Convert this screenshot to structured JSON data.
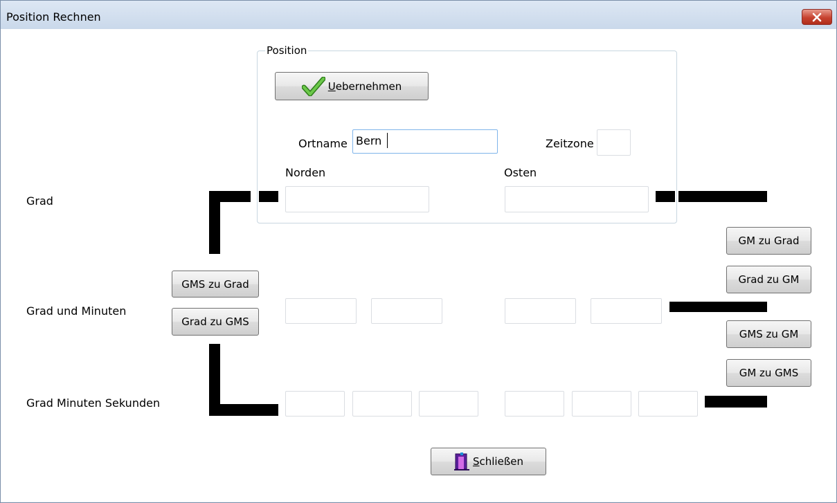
{
  "window": {
    "title": "Position Rechnen"
  },
  "group": {
    "legend": "Position"
  },
  "buttons": {
    "uebernehmen": {
      "accel": "U",
      "rest": "ebernehmen"
    },
    "schliessen": {
      "accel": "S",
      "rest": "chließen"
    },
    "gms_zu_grad": "GMS zu Grad",
    "grad_zu_gms": "Grad zu GMS",
    "gm_zu_grad": "GM zu Grad",
    "grad_zu_gm": "Grad zu GM",
    "gms_zu_gm": "GMS zu GM",
    "gm_zu_gms": "GM zu GMS"
  },
  "fields": {
    "ortname_label": "Ortname",
    "ortname_value": "Bern",
    "zeitzone_label": "Zeitzone",
    "zeitzone_value": "",
    "norden_label": "Norden",
    "osten_label": "Osten"
  },
  "rows": {
    "grad": "Grad",
    "grad_minuten": "Grad und Minuten",
    "grad_minuten_sekunden": "Grad Minuten Sekunden"
  },
  "icons": {
    "uebernehmen": "checkmark-icon",
    "schliessen": "exit-door-icon",
    "close": "close-x-icon"
  },
  "colors": {
    "checkmark": "#4aa82c",
    "close_button": "#c7422f",
    "exit_icon": "#6a2db0"
  }
}
